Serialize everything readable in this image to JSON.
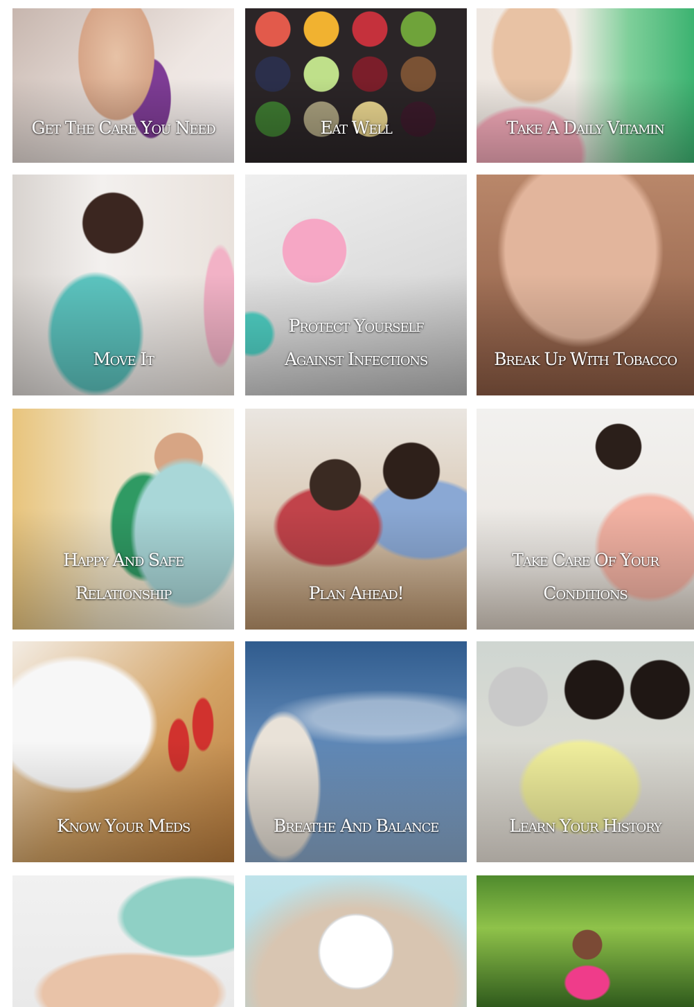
{
  "tiles": [
    {
      "label": "Get The Care You Need",
      "icon": "doctor-stethoscope-photo"
    },
    {
      "label": "Eat Well",
      "icon": "healthy-food-hearts-photo"
    },
    {
      "label": "Take A Daily Vitamin",
      "icon": "woman-vitamin-bottle-photo"
    },
    {
      "label": "Move It",
      "icon": "woman-exercising-photo"
    },
    {
      "label": "Protect Yourself\nAgainst Infections",
      "icon": "condoms-photo"
    },
    {
      "label": "Break Up With Tobacco",
      "icon": "woman-breaking-cigarette-photo"
    },
    {
      "label": "Happy And Safe Relationship",
      "icon": "couple-cooking-photo"
    },
    {
      "label": "Plan Ahead!",
      "icon": "couple-planning-photo"
    },
    {
      "label": "Take Care Of Your\nConditions",
      "icon": "woman-at-table-photo"
    },
    {
      "label": "Know Your Meds",
      "icon": "pill-organizer-photo"
    },
    {
      "label": "Breathe And Balance",
      "icon": "woman-sky-photo"
    },
    {
      "label": "Learn Your History",
      "icon": "three-generations-photo"
    },
    {
      "label": "",
      "icon": "hands-clasped-photo"
    },
    {
      "label": "",
      "icon": "alarm-clock-photo"
    },
    {
      "label": "",
      "icon": "woman-in-forest-photo"
    }
  ]
}
